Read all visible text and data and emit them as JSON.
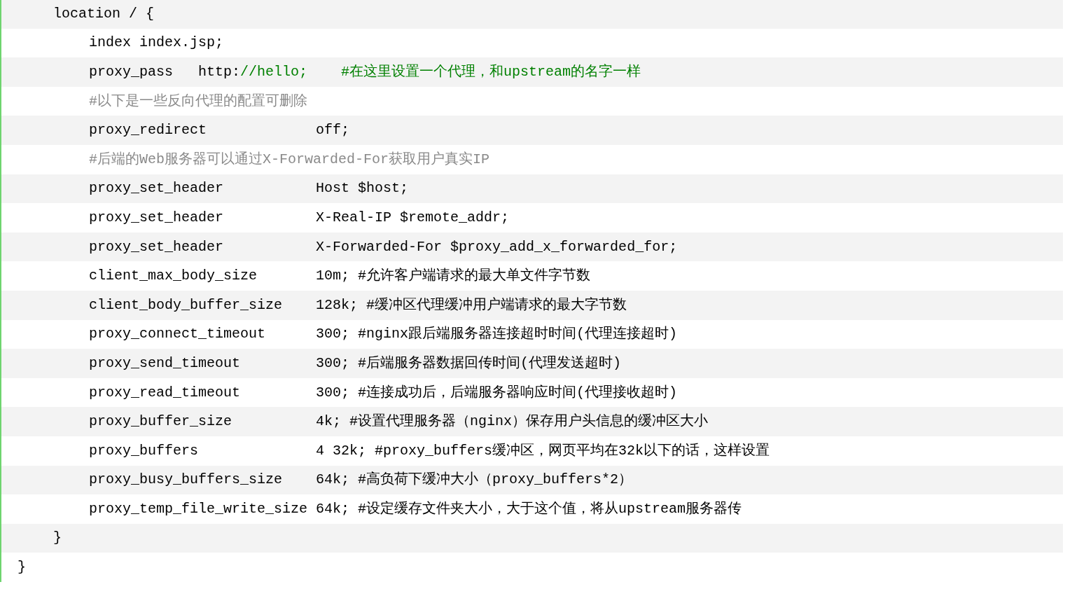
{
  "code_lines": [
    {
      "segments": [
        {
          "text": "location / {",
          "kind": "plain"
        }
      ],
      "children": [
        {
          "segments": [
            {
              "text": "index index.jsp;",
              "kind": "plain"
            }
          ]
        },
        {
          "segments": [
            {
              "text": "proxy_pass   http:",
              "kind": "plain"
            },
            {
              "text": "//hello;    #在这里设置一个代理，和upstream的名字一样",
              "kind": "string"
            }
          ]
        },
        {
          "segments": [
            {
              "text": "#以下是一些反向代理的配置可删除",
              "kind": "comment"
            }
          ]
        },
        {
          "segments": [
            {
              "text": "proxy_redirect             off;",
              "kind": "plain"
            }
          ]
        },
        {
          "segments": [
            {
              "text": "#后端的Web服务器可以通过X-Forwarded-For获取用户真实IP",
              "kind": "comment"
            }
          ]
        },
        {
          "segments": [
            {
              "text": "proxy_set_header           Host $host;",
              "kind": "plain"
            }
          ]
        },
        {
          "segments": [
            {
              "text": "proxy_set_header           X-Real-IP $remote_addr;",
              "kind": "plain"
            }
          ]
        },
        {
          "segments": [
            {
              "text": "proxy_set_header           X-Forwarded-For $proxy_add_x_forwarded_for;",
              "kind": "plain"
            }
          ]
        },
        {
          "segments": [
            {
              "text": "client_max_body_size       10m; #允许客户端请求的最大单文件字节数",
              "kind": "plain"
            }
          ]
        },
        {
          "segments": [
            {
              "text": "client_body_buffer_size    128k; #缓冲区代理缓冲用户端请求的最大字节数",
              "kind": "plain"
            }
          ]
        },
        {
          "segments": [
            {
              "text": "proxy_connect_timeout      300; #nginx跟后端服务器连接超时时间(代理连接超时)",
              "kind": "plain"
            }
          ]
        },
        {
          "segments": [
            {
              "text": "proxy_send_timeout         300; #后端服务器数据回传时间(代理发送超时)",
              "kind": "plain"
            }
          ]
        },
        {
          "segments": [
            {
              "text": "proxy_read_timeout         300; #连接成功后，后端服务器响应时间(代理接收超时)",
              "kind": "plain"
            }
          ]
        },
        {
          "segments": [
            {
              "text": "proxy_buffer_size          4k; #设置代理服务器（nginx）保存用户头信息的缓冲区大小",
              "kind": "plain"
            }
          ]
        },
        {
          "segments": [
            {
              "text": "proxy_buffers              4 32k; #proxy_buffers缓冲区，网页平均在32k以下的话，这样设置",
              "kind": "plain"
            }
          ]
        },
        {
          "segments": [
            {
              "text": "proxy_busy_buffers_size    64k; #高负荷下缓冲大小（proxy_buffers*2）",
              "kind": "plain"
            }
          ]
        },
        {
          "segments": [
            {
              "text": "proxy_temp_file_write_size 64k; #设定缓存文件夹大小，大于这个值，将从upstream服务器传",
              "kind": "plain"
            }
          ]
        }
      ]
    },
    {
      "segments": [
        {
          "text": "}",
          "kind": "plain"
        }
      ]
    }
  ],
  "closing_line": {
    "segments": [
      {
        "text": "}",
        "kind": "plain"
      }
    ]
  }
}
